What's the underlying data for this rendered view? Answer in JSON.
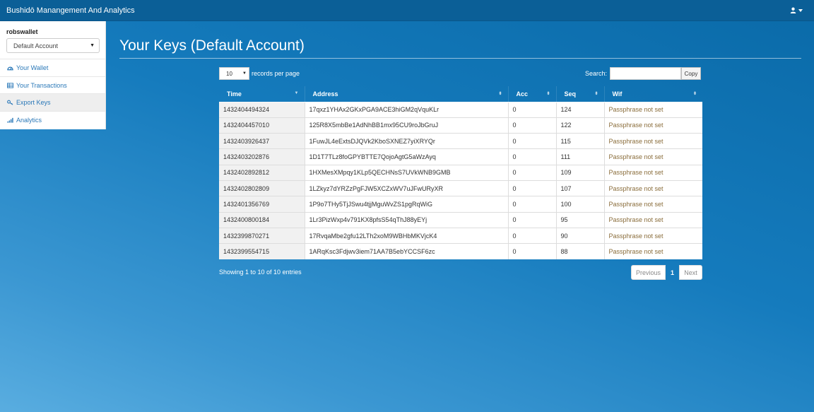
{
  "app": {
    "title": "Bushidō Manangement And Analytics"
  },
  "sidebar": {
    "wallet_name": "robswallet",
    "account_select": "Default Account",
    "items": [
      {
        "label": "Your Wallet",
        "icon": "dashboard-icon"
      },
      {
        "label": "Your Transactions",
        "icon": "table-icon"
      },
      {
        "label": "Export Keys",
        "icon": "key-icon",
        "active": true
      },
      {
        "label": "Analytics",
        "icon": "signal-icon"
      }
    ]
  },
  "page": {
    "title": "Your Keys (Default Account)"
  },
  "controls": {
    "page_length": "10",
    "records_label": "records per page",
    "search_label": "Search:",
    "search_value": "",
    "copy_label": "Copy"
  },
  "table": {
    "headers": [
      "Time",
      "Address",
      "Acc",
      "Seq",
      "Wif"
    ],
    "rows": [
      [
        "1432404494324",
        "17qxz1YHAx2GKxPGA9ACE3hiGM2qVquKLr",
        "0",
        "124",
        "Passphrase not set"
      ],
      [
        "1432404457010",
        "125R8X5mbBe1AdNhBB1mx95CU9roJbGruJ",
        "0",
        "122",
        "Passphrase not set"
      ],
      [
        "1432403926437",
        "1FuwJL4eExtsDJQVk2KboSXNEZ7yiXRYQr",
        "0",
        "115",
        "Passphrase not set"
      ],
      [
        "1432403202876",
        "1D1T7TLz8foGPYBTTE7QojoAgtG5aWzAyq",
        "0",
        "111",
        "Passphrase not set"
      ],
      [
        "1432402892812",
        "1HXMesXMpqy1KLp5QECHNsS7UVkWNB9GMB",
        "0",
        "109",
        "Passphrase not set"
      ],
      [
        "1432402802809",
        "1LZkyz7dYRZzPgFJW5XCZxWV7uJFwURyXR",
        "0",
        "107",
        "Passphrase not set"
      ],
      [
        "1432401356769",
        "1P9o7THy5TjJSwu4tjjMguWvZS1pgRqWiG",
        "0",
        "100",
        "Passphrase not set"
      ],
      [
        "1432400800184",
        "1Lr3PizWxp4v791KX8pfsS54qThJ88yEYj",
        "0",
        "95",
        "Passphrase not set"
      ],
      [
        "1432399870271",
        "17RvqaMbe2gfu12LTh2xoM9WBHbMKVjcK4",
        "0",
        "90",
        "Passphrase not set"
      ],
      [
        "1432399554715",
        "1ARqKsc3Fdjwv3iem71AA7B5ebYCCSF6zc",
        "0",
        "88",
        "Passphrase not set"
      ]
    ]
  },
  "footer": {
    "info": "Showing 1 to 10 of 10 entries",
    "prev": "Previous",
    "page": "1",
    "next": "Next"
  }
}
